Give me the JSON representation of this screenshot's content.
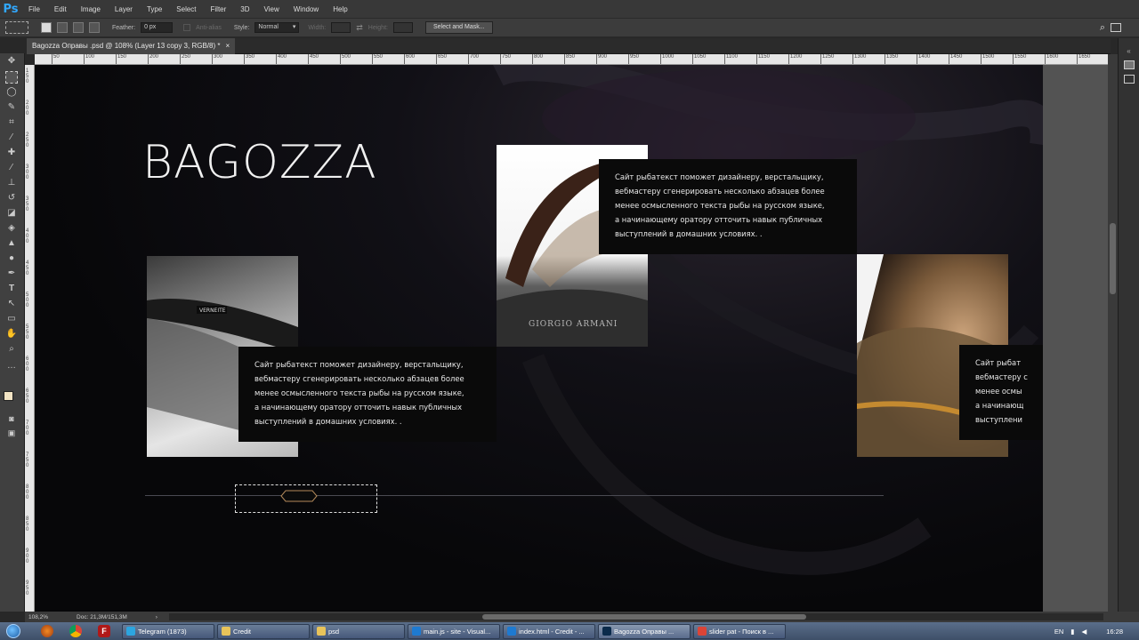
{
  "app": {
    "logo": "Ps",
    "menu": [
      "File",
      "Edit",
      "Image",
      "Layer",
      "Type",
      "Select",
      "Filter",
      "3D",
      "View",
      "Window",
      "Help"
    ]
  },
  "options": {
    "feather_label": "Feather:",
    "feather_value": "0 px",
    "antialias_label": "Anti-alias",
    "style_label": "Style:",
    "style_value": "Normal",
    "width_label": "Width:",
    "height_label": "Height:",
    "select_mask": "Select and Mask..."
  },
  "document_tab": {
    "title": "Bagozza  Оправы  .psd @ 108% (Layer 13 copy 3, RGB/8) *",
    "close": "×"
  },
  "ruler_top": [
    "50",
    "100",
    "150",
    "200",
    "250",
    "300",
    "350",
    "400",
    "450",
    "500",
    "550",
    "600",
    "650",
    "700",
    "750",
    "800",
    "850",
    "900",
    "950",
    "1000",
    "1050",
    "1100",
    "1150",
    "1200",
    "1250",
    "1300",
    "1350",
    "1400",
    "1450",
    "1500",
    "1550",
    "1600",
    "1650"
  ],
  "ruler_left": [
    "150",
    "200",
    "250",
    "300",
    "350",
    "400",
    "450",
    "500",
    "550",
    "600",
    "650",
    "700",
    "750",
    "800",
    "850",
    "900",
    "950"
  ],
  "page": {
    "brand": "BAGOZZA",
    "photo_label_1": "VERNEITE",
    "photo_label_2": "GIORGIO ARMANI",
    "card_text": "Сайт рыбатекст поможет дизайнеру, верстальщику, вебмастеру сгенерировать несколько абзацев более менее осмысленного текста рыбы на русском языке, а начинающему оратору отточить навык публичных выступлений в домашних условиях. .",
    "card_lines": [
      "Сайт рыбатекст поможет дизайнеру, верстальщику,",
      "вебмастеру сгенерировать несколько абзацев более",
      "менее осмысленного текста рыбы на русском языке,",
      "а начинающему оратору отточить навык публичных",
      "выступлений в домашних условиях. ."
    ],
    "card_lines_right": [
      "Сайт рыбат",
      "вебмастеру с",
      "менее осмы",
      "а начинающ",
      "выступлени"
    ]
  },
  "status": {
    "zoom": "108,2%",
    "doc": "Doc: 21,3M/151,3M",
    "arrow": "›"
  },
  "taskbar": {
    "tasks": [
      {
        "label": "Telegram (1873)",
        "color": "#2ca5e0"
      },
      {
        "label": "Credit",
        "color": "#e8c35a"
      },
      {
        "label": "psd",
        "color": "#e8c35a"
      },
      {
        "label": "main.js - site - Visual...",
        "color": "#1e7ad1"
      },
      {
        "label": "index.html - Credit - ...",
        "color": "#1e7ad1"
      },
      {
        "label": "Bagozza  Оправы  ...",
        "color": "#0b2b4b"
      },
      {
        "label": "slider pat - Поиск в ...",
        "color": "#db4437"
      }
    ],
    "lang": "EN",
    "time": "16:28"
  },
  "colors": {
    "foreground": "#f2e4c4",
    "background": "#ffffff",
    "accent": "#31a8ff"
  }
}
